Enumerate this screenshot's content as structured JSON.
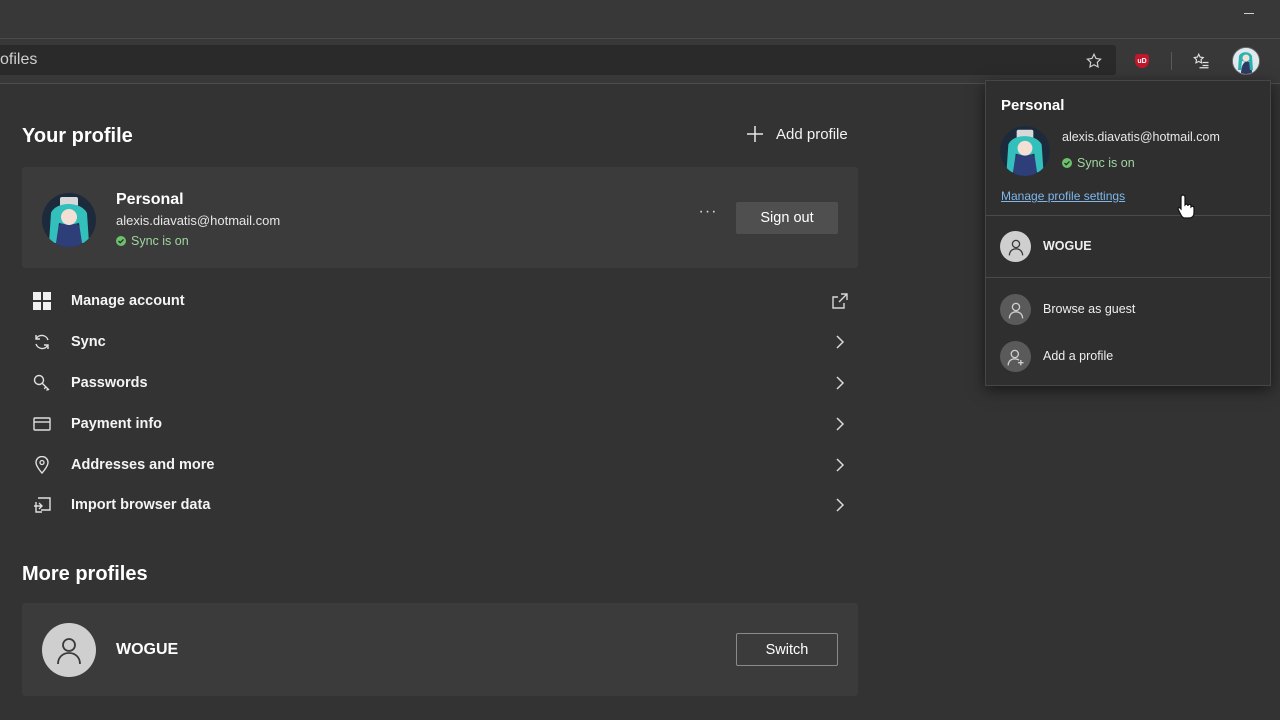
{
  "browser": {
    "address_text": "ofiles",
    "toolbar_icons": [
      "favorite-star-icon",
      "ublock-icon",
      "favorites-collection-icon",
      "profile-avatar-icon"
    ]
  },
  "your_profile": {
    "title": "Your profile",
    "add_profile_label": "Add profile",
    "card": {
      "name": "Personal",
      "email": "alexis.diavatis@hotmail.com",
      "sync_status": "Sync is on",
      "more_label": "···",
      "sign_out_label": "Sign out"
    }
  },
  "menu": {
    "items": [
      {
        "label": "Manage account",
        "icon": "windows-grid-icon",
        "trail": "external-link-icon"
      },
      {
        "label": "Sync",
        "icon": "sync-icon",
        "trail": "chevron-right-icon"
      },
      {
        "label": "Passwords",
        "icon": "key-icon",
        "trail": "chevron-right-icon"
      },
      {
        "label": "Payment info",
        "icon": "credit-card-icon",
        "trail": "chevron-right-icon"
      },
      {
        "label": "Addresses and more",
        "icon": "location-pin-icon",
        "trail": "chevron-right-icon"
      },
      {
        "label": "Import browser data",
        "icon": "import-icon",
        "trail": "chevron-right-icon"
      }
    ]
  },
  "more_profiles": {
    "title": "More profiles",
    "profile": {
      "name": "WOGUE",
      "switch_label": "Switch"
    }
  },
  "flyout": {
    "title": "Personal",
    "email": "alexis.diavatis@hotmail.com",
    "sync_status": "Sync is on",
    "manage_link": "Manage profile settings",
    "other_profile": "WOGUE",
    "guest_label": "Browse as guest",
    "add_label": "Add a profile"
  },
  "colors": {
    "background": "#333333",
    "card": "#3b3b3b",
    "sync_green": "#6cc26c",
    "link_blue": "#7fb6ea"
  }
}
